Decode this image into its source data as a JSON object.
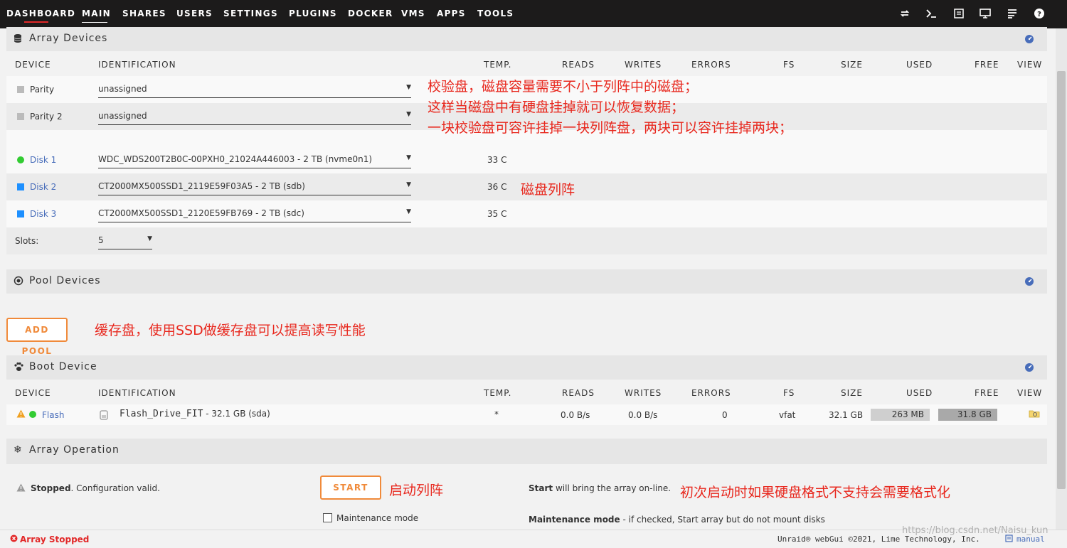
{
  "nav": {
    "tabs": [
      "DASHBOARD",
      "MAIN",
      "SHARES",
      "USERS",
      "SETTINGS",
      "PLUGINS",
      "DOCKER",
      "VMS",
      "APPS",
      "TOOLS"
    ],
    "active": "MAIN",
    "icons": [
      "refresh-icon",
      "terminal-icon",
      "log-icon",
      "monitor-icon",
      "menu-lines-icon",
      "help-icon"
    ]
  },
  "array": {
    "title": "Array Devices",
    "columns": {
      "device": "DEVICE",
      "identification": "IDENTIFICATION",
      "temp": "TEMP.",
      "reads": "READS",
      "writes": "WRITES",
      "errors": "ERRORS",
      "fs": "FS",
      "size": "SIZE",
      "used": "USED",
      "free": "FREE",
      "view": "VIEW"
    },
    "parity": [
      {
        "name": "Parity",
        "value": "unassigned"
      },
      {
        "name": "Parity 2",
        "value": "unassigned"
      }
    ],
    "disks": [
      {
        "name": "Disk 1",
        "value": "WDC_WDS200T2B0C-00PXH0_21024A446003 - 2 TB (nvme0n1)",
        "temp": "33 C",
        "status_color": "#33cc33",
        "shape": "circle"
      },
      {
        "name": "Disk 2",
        "value": "CT2000MX500SSD1_2119E59F03A5 - 2 TB (sdb)",
        "temp": "36 C",
        "status_color": "#1e90ff",
        "shape": "square"
      },
      {
        "name": "Disk 3",
        "value": "CT2000MX500SSD1_2120E59FB769 - 2 TB (sdc)",
        "temp": "35 C",
        "status_color": "#1e90ff",
        "shape": "square"
      }
    ],
    "slots_label": "Slots:",
    "slots_value": "5"
  },
  "pool": {
    "title": "Pool Devices",
    "add_pool": "ADD POOL"
  },
  "boot": {
    "title": "Boot Device",
    "device": {
      "name": "Flash",
      "id_name": "Flash_Drive_FIT",
      "id_detail": " - 32.1 GB (sda)",
      "temp": "*",
      "reads": "0.0 B/s",
      "writes": "0.0 B/s",
      "errors": "0",
      "fs": "vfat",
      "size": "32.1 GB",
      "used": "263 MB",
      "free": "31.8 GB"
    }
  },
  "operation": {
    "title": "Array Operation",
    "status_bold": "Stopped",
    "status_rest": ". Configuration valid.",
    "start_button": "START",
    "maintenance_label": "Maintenance mode",
    "start_help_bold": "Start",
    "start_help_rest": " will bring the array on-line.",
    "maint_help_bold": "Maintenance mode",
    "maint_help_rest": " - if checked, Start array but do not mount disks"
  },
  "annotations": {
    "parity_note_1": "校验盘，磁盘容量需要不小于列阵中的磁盘；",
    "parity_note_2": "这样当磁盘中有硬盘挂掉就可以恢复数据；",
    "parity_note_3": "一块校验盘可容许挂掉一块列阵盘，两块可以容许挂掉两块；",
    "disk_note": "磁盘列阵",
    "pool_note": "缓存盘，使用SSD做缓存盘可以提高读写性能",
    "start_note": "启动列阵",
    "format_note": "初次启动时如果硬盘格式不支持会需要格式化"
  },
  "footer": {
    "status": "Array Stopped",
    "copyright": "Unraid® webGui ©2021, Lime Technology, Inc.",
    "manual": "manual",
    "watermark": "https://blog.csdn.net/Naisu_kun"
  }
}
